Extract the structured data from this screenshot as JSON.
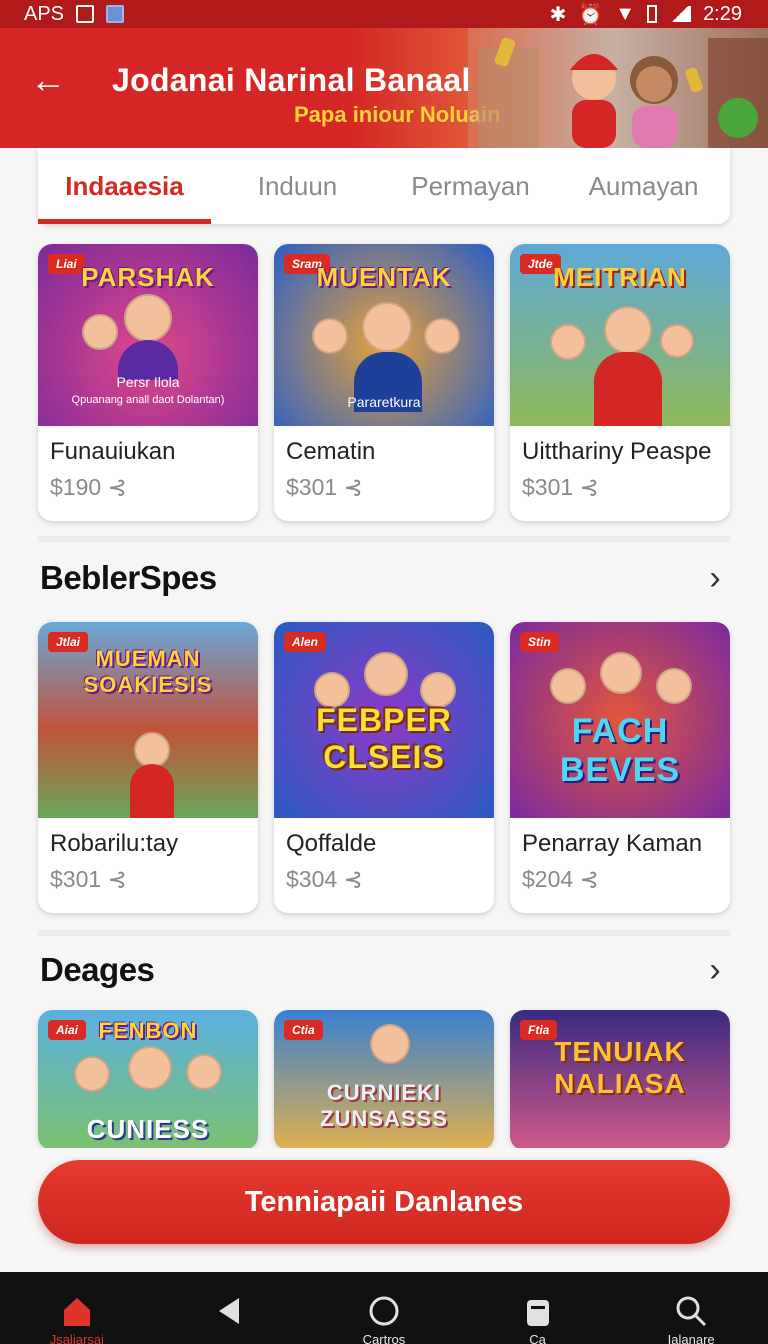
{
  "status_bar": {
    "left_text": "APS",
    "time": "2:29"
  },
  "header": {
    "title": "Jodanai Narinal Banaal",
    "subtitle": "Papa iniour Noluain"
  },
  "tabs": [
    {
      "label": "Indaaesia",
      "active": true
    },
    {
      "label": "Induun",
      "active": false
    },
    {
      "label": "Permayan",
      "active": false
    },
    {
      "label": "Aumayan",
      "active": false
    }
  ],
  "featured": [
    {
      "badge": "Liai",
      "art_title": "PARSHAK",
      "caption1": "Persr Ilola",
      "caption2": "Qpuanang anall daot Dolantan)",
      "name": "Funauiukan",
      "price": "$190",
      "colors": [
        "#7a2a9a",
        "#e0478a"
      ]
    },
    {
      "badge": "Sram",
      "art_title": "MUENTAK",
      "caption1": "Pararetkura",
      "caption2": "",
      "name": "Cematin",
      "price": "$301",
      "colors": [
        "#2a5ec8",
        "#e6a23a"
      ]
    },
    {
      "badge": "Jtde",
      "art_title": "MEITRIAN",
      "caption1": "",
      "caption2": "",
      "name": "Uitthariny Peaspe",
      "price": "$301",
      "colors": [
        "#5ea8d8",
        "#8fb85a"
      ]
    }
  ],
  "section1": {
    "title": "BeblerSpes",
    "cards": [
      {
        "badge": "Jtlai",
        "art_title": "MUEMAN SOAKIESIS",
        "big_title": "",
        "name": "Robarilu:tay",
        "price": "$301",
        "colors": [
          "#c0533a",
          "#6aa8d8"
        ]
      },
      {
        "badge": "Alen",
        "art_title": "",
        "big_title": "FEBPER CLSEIS",
        "name": "Qoffalde",
        "price": "$304",
        "colors": [
          "#2a5ac0",
          "#8d3ac8"
        ]
      },
      {
        "badge": "Stin",
        "art_title": "",
        "big_title": "FACH BEVES",
        "name": "Penarray Kaman",
        "price": "$204",
        "colors": [
          "#7a2aa0",
          "#e2563a"
        ]
      }
    ]
  },
  "section2": {
    "title": "Deages",
    "cards": [
      {
        "badge": "Aiai",
        "art_title": "FENBON",
        "big_title": "CUNIESS",
        "colors": [
          "#5ab0e0",
          "#7cc070"
        ]
      },
      {
        "badge": "Ctia",
        "art_title": "",
        "big_title": "CURNIEKI ZUNSASSS",
        "colors": [
          "#3a80d0",
          "#e0b050"
        ]
      },
      {
        "badge": "Ftia",
        "art_title": "TENUIAK NALIASA",
        "big_title": "",
        "colors": [
          "#3a2a80",
          "#d05a8a"
        ]
      }
    ]
  },
  "cta": {
    "label": "Tenniapaii Danlanes"
  },
  "bottom_nav": [
    {
      "label": "Jsaliarsai",
      "icon": "home-icon",
      "active": true
    },
    {
      "label": "",
      "icon": "back-triangle-icon",
      "active": false
    },
    {
      "label": "Cartros",
      "icon": "circle-icon",
      "active": false
    },
    {
      "label": "Ca",
      "icon": "bag-icon",
      "active": false
    },
    {
      "label": "Ialanare",
      "icon": "search-icon",
      "active": false
    }
  ],
  "accent_color": "#d32a22"
}
